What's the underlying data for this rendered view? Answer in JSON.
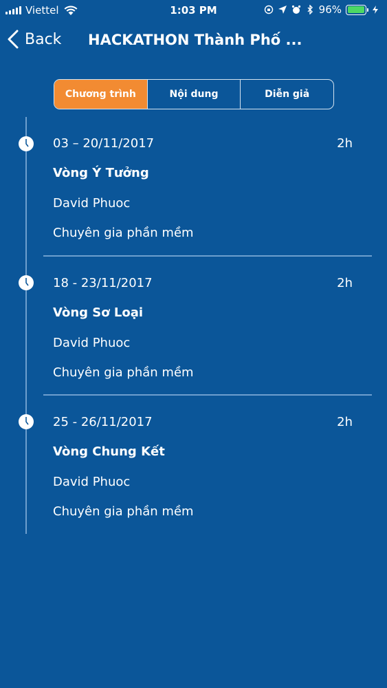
{
  "status_bar": {
    "carrier": "Viettel",
    "time": "1:03 PM",
    "battery_percent": "96%",
    "battery_level": 0.96
  },
  "nav": {
    "back_label": "Back",
    "title": "HACKATHON Thành Phố ..."
  },
  "tabs": [
    {
      "label": "Chương trình",
      "active": true
    },
    {
      "label": "Nội dung",
      "active": false
    },
    {
      "label": "Diễn giả",
      "active": false
    }
  ],
  "events": [
    {
      "date": "03 – 20/11/2017",
      "duration": "2h",
      "title": "Vòng Ý Tưởng",
      "speaker": "David Phuoc",
      "role": "Chuyên gia phần mềm"
    },
    {
      "date": "18 - 23/11/2017",
      "duration": "2h",
      "title": "Vòng Sơ Loại",
      "speaker": "David Phuoc",
      "role": "Chuyên gia phần mềm"
    },
    {
      "date": "25 - 26/11/2017",
      "duration": "2h",
      "title": "Vòng Chung Kết",
      "speaker": "David Phuoc",
      "role": "Chuyên gia phần mềm"
    }
  ],
  "icons": {
    "event": "clock-icon",
    "back": "chevron-left-icon"
  },
  "colors": {
    "background": "#0b5699",
    "active_tab": "#f28b32",
    "timeline": "#6e9fce"
  }
}
